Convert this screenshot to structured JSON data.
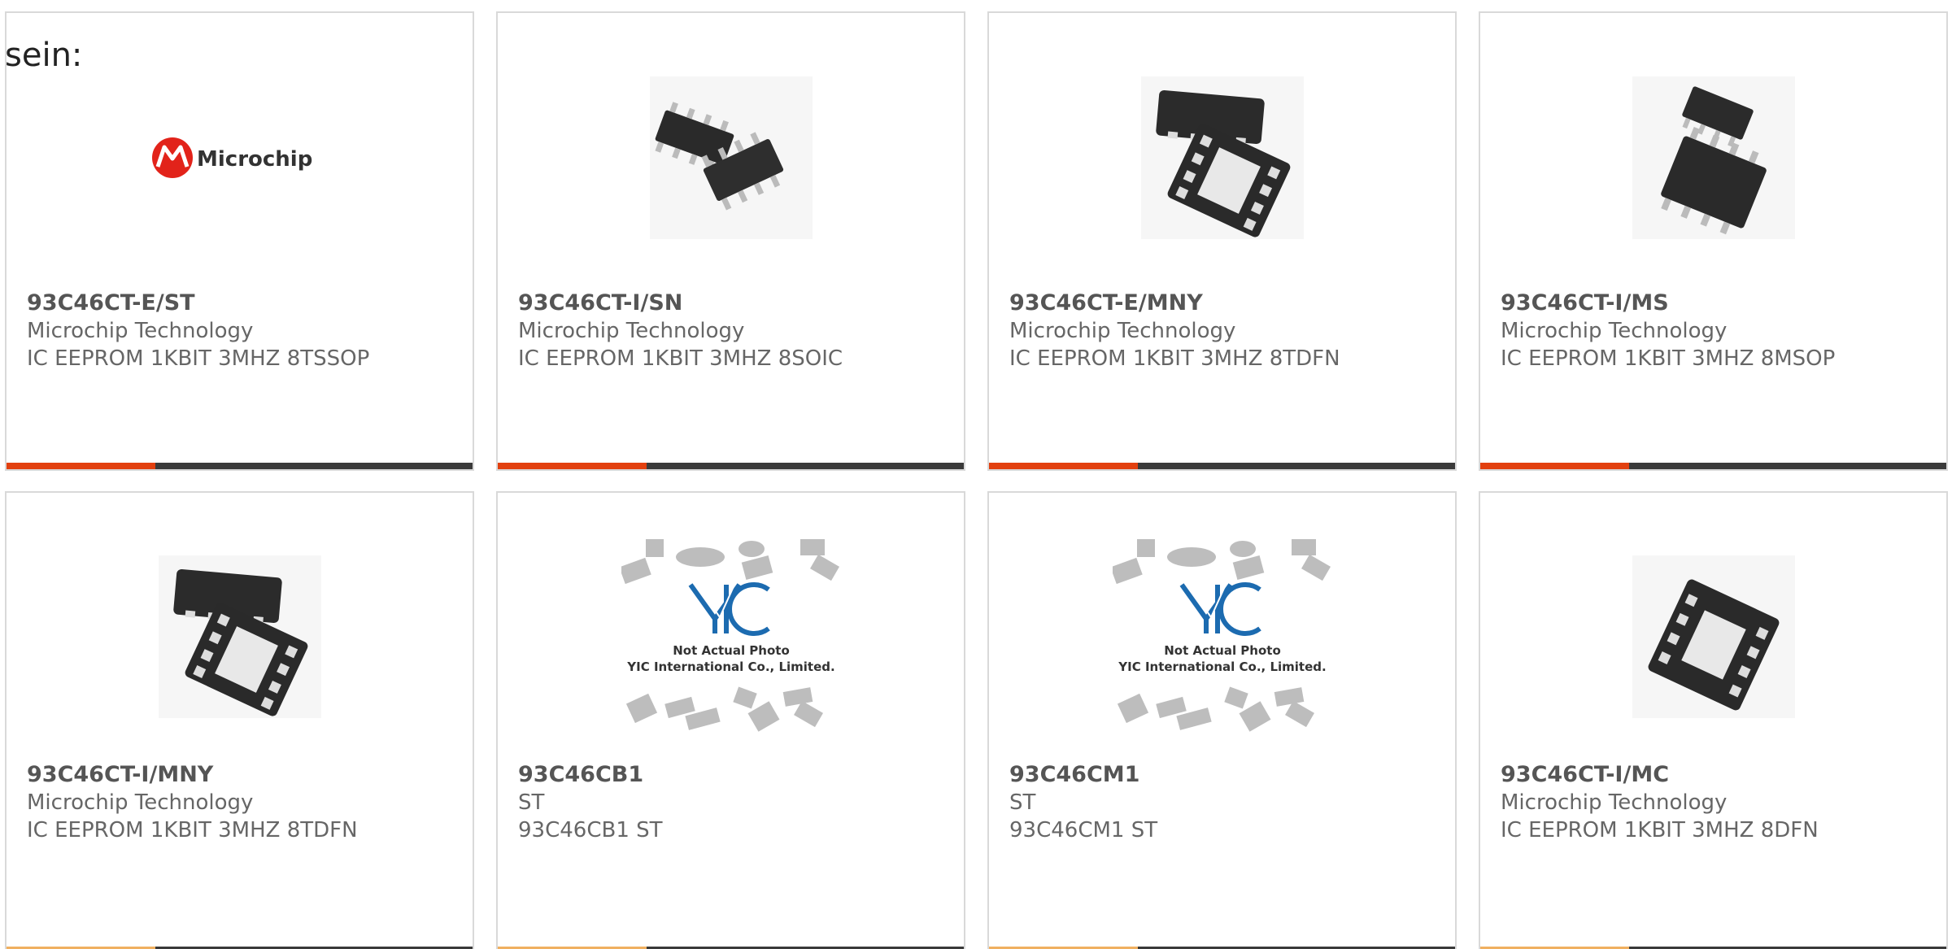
{
  "intro": {
    "text": "sein:"
  },
  "brand": {
    "accent_color": "#e2400f",
    "bar_color": "#3a3a3a"
  },
  "placeholder": {
    "logo": "YIC",
    "line1": "Not Actual Photo",
    "line2": "YIC International Co., Limited."
  },
  "microchip_logo": {
    "text": "Microchip"
  },
  "products": [
    {
      "part": "93C46CT-E/ST",
      "manufacturer": "Microchip Technology",
      "description": "IC EEPROM 1KBIT 3MHZ 8TSSOP",
      "image": "microchip-logo"
    },
    {
      "part": "93C46CT-I/SN",
      "manufacturer": "Microchip Technology",
      "description": "IC EEPROM 1KBIT 3MHZ 8SOIC",
      "image": "soic-chips"
    },
    {
      "part": "93C46CT-E/MNY",
      "manufacturer": "Microchip Technology",
      "description": "IC EEPROM 1KBIT 3MHZ 8TDFN",
      "image": "tdfn-chips"
    },
    {
      "part": "93C46CT-I/MS",
      "manufacturer": "Microchip Technology",
      "description": "IC EEPROM 1KBIT 3MHZ 8MSOP",
      "image": "msop-chips"
    },
    {
      "part": "93C46CT-I/MNY",
      "manufacturer": "Microchip Technology",
      "description": "IC EEPROM 1KBIT 3MHZ 8TDFN",
      "image": "tdfn-chips"
    },
    {
      "part": "93C46CB1",
      "manufacturer": "ST",
      "description": "93C46CB1 ST",
      "image": "not-actual-photo"
    },
    {
      "part": "93C46CM1",
      "manufacturer": "ST",
      "description": "93C46CM1 ST",
      "image": "not-actual-photo"
    },
    {
      "part": "93C46CT-I/MC",
      "manufacturer": "Microchip Technology",
      "description": "IC EEPROM 1KBIT 3MHZ 8DFN",
      "image": "dfn-chip"
    }
  ]
}
